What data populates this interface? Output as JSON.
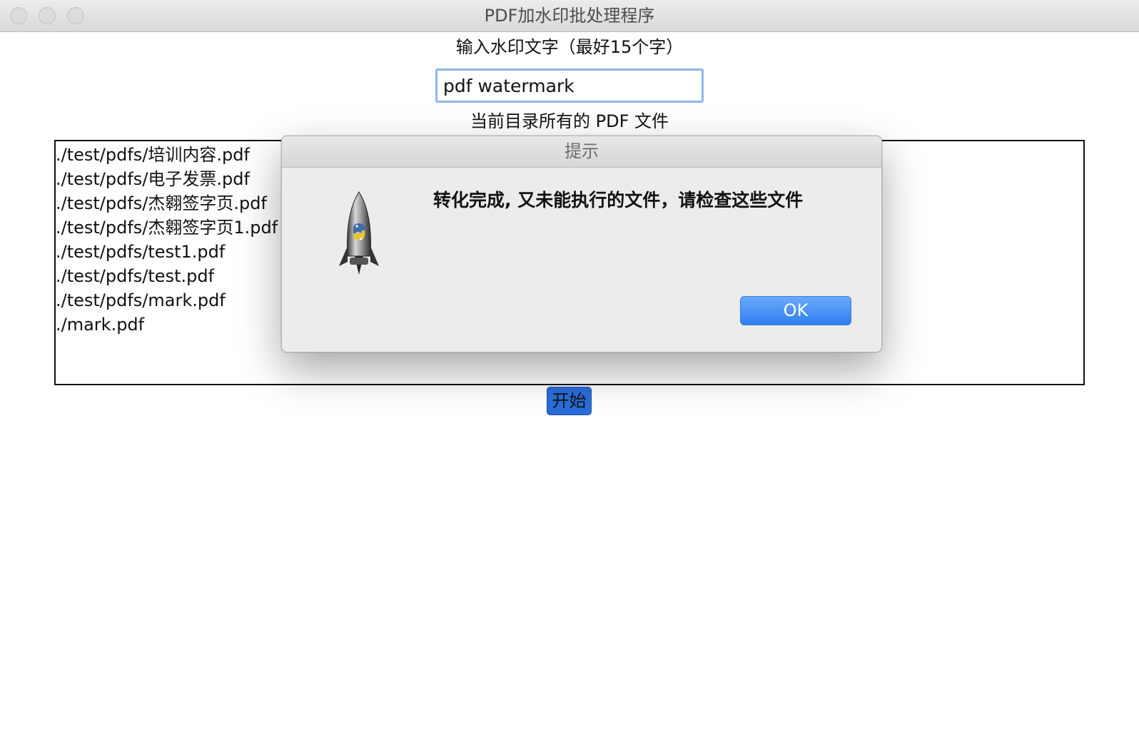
{
  "window": {
    "title": "PDF加水印批处理程序"
  },
  "watermark": {
    "label": "输入水印文字（最好15个字）",
    "value": "pdf watermark"
  },
  "files": {
    "label": "当前目录所有的 PDF 文件",
    "items": [
      "./test/pdfs/培训内容.pdf",
      "./test/pdfs/电子发票.pdf",
      "./test/pdfs/杰翱签字页.pdf",
      "./test/pdfs/杰翱签字页1.pdf",
      "./test/pdfs/test1.pdf",
      "./test/pdfs/test.pdf",
      "./test/pdfs/mark.pdf",
      "./mark.pdf"
    ]
  },
  "actions": {
    "start_label": "开始"
  },
  "dialog": {
    "title": "提示",
    "message": "转化完成, 又未能执行的文件，请检查这些文件",
    "ok_label": "OK",
    "icon": "python-launcher-rocket-icon"
  },
  "colors": {
    "start_button_bg": "#2a6dd9",
    "ok_button_bg": "#3b86f2",
    "input_focus_ring": "#8fb7ec"
  }
}
